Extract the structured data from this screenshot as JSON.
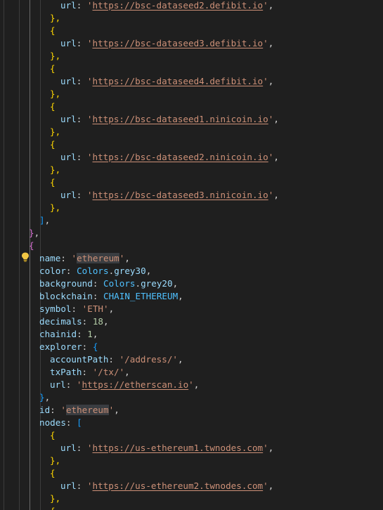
{
  "code": {
    "lines": [
      [
        [
          "url",
          "k"
        ],
        [
          ": ",
          "p"
        ],
        [
          "'",
          "s"
        ],
        [
          "https://bsc-dataseed2.defibit.io",
          "u"
        ],
        [
          "'",
          "s"
        ],
        [
          ",",
          "p"
        ]
      ],
      [
        [
          "},",
          "b1"
        ]
      ],
      [
        [
          "{",
          "b1"
        ]
      ],
      [
        [
          "url",
          "k"
        ],
        [
          ": ",
          "p"
        ],
        [
          "'",
          "s"
        ],
        [
          "https://bsc-dataseed3.defibit.io",
          "u"
        ],
        [
          "'",
          "s"
        ],
        [
          ",",
          "p"
        ]
      ],
      [
        [
          "},",
          "b1"
        ]
      ],
      [
        [
          "{",
          "b1"
        ]
      ],
      [
        [
          "url",
          "k"
        ],
        [
          ": ",
          "p"
        ],
        [
          "'",
          "s"
        ],
        [
          "https://bsc-dataseed4.defibit.io",
          "u"
        ],
        [
          "'",
          "s"
        ],
        [
          ",",
          "p"
        ]
      ],
      [
        [
          "},",
          "b1"
        ]
      ],
      [
        [
          "{",
          "b1"
        ]
      ],
      [
        [
          "url",
          "k"
        ],
        [
          ": ",
          "p"
        ],
        [
          "'",
          "s"
        ],
        [
          "https://bsc-dataseed1.ninicoin.io",
          "u"
        ],
        [
          "'",
          "s"
        ],
        [
          ",",
          "p"
        ]
      ],
      [
        [
          "},",
          "b1"
        ]
      ],
      [
        [
          "{",
          "b1"
        ]
      ],
      [
        [
          "url",
          "k"
        ],
        [
          ": ",
          "p"
        ],
        [
          "'",
          "s"
        ],
        [
          "https://bsc-dataseed2.ninicoin.io",
          "u"
        ],
        [
          "'",
          "s"
        ],
        [
          ",",
          "p"
        ]
      ],
      [
        [
          "},",
          "b1"
        ]
      ],
      [
        [
          "{",
          "b1"
        ]
      ],
      [
        [
          "url",
          "k"
        ],
        [
          ": ",
          "p"
        ],
        [
          "'",
          "s"
        ],
        [
          "https://bsc-dataseed3.ninicoin.io",
          "u"
        ],
        [
          "'",
          "s"
        ],
        [
          ",",
          "p"
        ]
      ],
      [
        [
          "},",
          "b1"
        ]
      ],
      [
        [
          "]",
          "b3"
        ],
        [
          ",",
          "p"
        ]
      ],
      [
        [
          "}",
          "b2"
        ],
        [
          ",",
          "p"
        ]
      ],
      [
        [
          "{",
          "b2"
        ]
      ],
      [
        [
          "name",
          "k"
        ],
        [
          ": ",
          "p"
        ],
        [
          "'",
          "s"
        ],
        [
          "ethereum",
          "s hl"
        ],
        [
          "'",
          "s"
        ],
        [
          ",",
          "p"
        ]
      ],
      [
        [
          "color",
          "k"
        ],
        [
          ": ",
          "p"
        ],
        [
          "Colors",
          "c"
        ],
        [
          ".",
          "p"
        ],
        [
          "grey30",
          "k"
        ],
        [
          ",",
          "p"
        ]
      ],
      [
        [
          "background",
          "k"
        ],
        [
          ": ",
          "p"
        ],
        [
          "Colors",
          "c"
        ],
        [
          ".",
          "p"
        ],
        [
          "grey20",
          "k"
        ],
        [
          ",",
          "p"
        ]
      ],
      [
        [
          "blockchain",
          "k"
        ],
        [
          ": ",
          "p"
        ],
        [
          "CHAIN_ETHEREUM",
          "c"
        ],
        [
          ",",
          "p"
        ]
      ],
      [
        [
          "symbol",
          "k"
        ],
        [
          ": ",
          "p"
        ],
        [
          "'ETH'",
          "s"
        ],
        [
          ",",
          "p"
        ]
      ],
      [
        [
          "decimals",
          "k"
        ],
        [
          ": ",
          "p"
        ],
        [
          "18",
          "n"
        ],
        [
          ",",
          "p"
        ]
      ],
      [
        [
          "chainid",
          "k"
        ],
        [
          ": ",
          "p"
        ],
        [
          "1",
          "n"
        ],
        [
          ",",
          "p"
        ]
      ],
      [
        [
          "explorer",
          "k"
        ],
        [
          ": ",
          "p"
        ],
        [
          "{",
          "b3"
        ]
      ],
      [
        [
          "accountPath",
          "k"
        ],
        [
          ": ",
          "p"
        ],
        [
          "'/address/'",
          "s"
        ],
        [
          ",",
          "p"
        ]
      ],
      [
        [
          "txPath",
          "k"
        ],
        [
          ": ",
          "p"
        ],
        [
          "'/tx/'",
          "s"
        ],
        [
          ",",
          "p"
        ]
      ],
      [
        [
          "url",
          "k"
        ],
        [
          ": ",
          "p"
        ],
        [
          "'",
          "s"
        ],
        [
          "https://etherscan.io",
          "u"
        ],
        [
          "'",
          "s"
        ],
        [
          ",",
          "p"
        ]
      ],
      [
        [
          "}",
          "b3"
        ],
        [
          ",",
          "p"
        ]
      ],
      [
        [
          "id",
          "k"
        ],
        [
          ": ",
          "p"
        ],
        [
          "'",
          "s"
        ],
        [
          "ethereum",
          "s hl"
        ],
        [
          "'",
          "s"
        ],
        [
          ",",
          "p"
        ]
      ],
      [
        [
          "nodes",
          "k"
        ],
        [
          ": ",
          "p"
        ],
        [
          "[",
          "b3"
        ]
      ],
      [
        [
          "{",
          "b1"
        ]
      ],
      [
        [
          "url",
          "k"
        ],
        [
          ": ",
          "p"
        ],
        [
          "'",
          "s"
        ],
        [
          "https://us-ethereum1.twnodes.com",
          "u"
        ],
        [
          "'",
          "s"
        ],
        [
          ",",
          "p"
        ]
      ],
      [
        [
          "},",
          "b1"
        ]
      ],
      [
        [
          "{",
          "b1"
        ]
      ],
      [
        [
          "url",
          "k"
        ],
        [
          ": ",
          "p"
        ],
        [
          "'",
          "s"
        ],
        [
          "https://us-ethereum2.twnodes.com",
          "u"
        ],
        [
          "'",
          "s"
        ],
        [
          ",",
          "p"
        ]
      ],
      [
        [
          "},",
          "b1"
        ]
      ],
      [
        [
          "{",
          "b1"
        ]
      ]
    ]
  },
  "colors": {
    "background": "#1f1f1f",
    "bracket_yellow": "#ffd700",
    "bracket_purple": "#da70d6",
    "bracket_blue": "#179fff",
    "string": "#ce9178",
    "property": "#9cdcfe",
    "constant": "#4fc1ff",
    "number": "#b5cea8"
  },
  "icons": {
    "lightbulb": "lightbulb-icon"
  }
}
